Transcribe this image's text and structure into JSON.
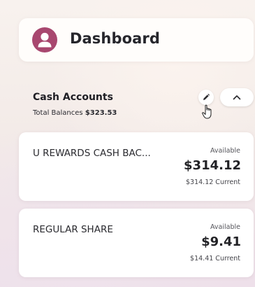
{
  "header": {
    "title": "Dashboard",
    "avatar_icon": "user-icon",
    "accent_color": "#a8476f"
  },
  "section": {
    "title": "Cash Accounts",
    "total_label": "Total Balances",
    "total_value": "$323.53",
    "edit_icon": "pencil-icon",
    "collapse_icon": "chevron-up-icon"
  },
  "accounts": [
    {
      "name": "U REWARDS CASH BAC...",
      "available_label": "Available",
      "balance": "$314.12",
      "current": "$314.12 Current"
    },
    {
      "name": "REGULAR SHARE",
      "available_label": "Available",
      "balance": "$9.41",
      "current": "$14.41 Current"
    }
  ]
}
